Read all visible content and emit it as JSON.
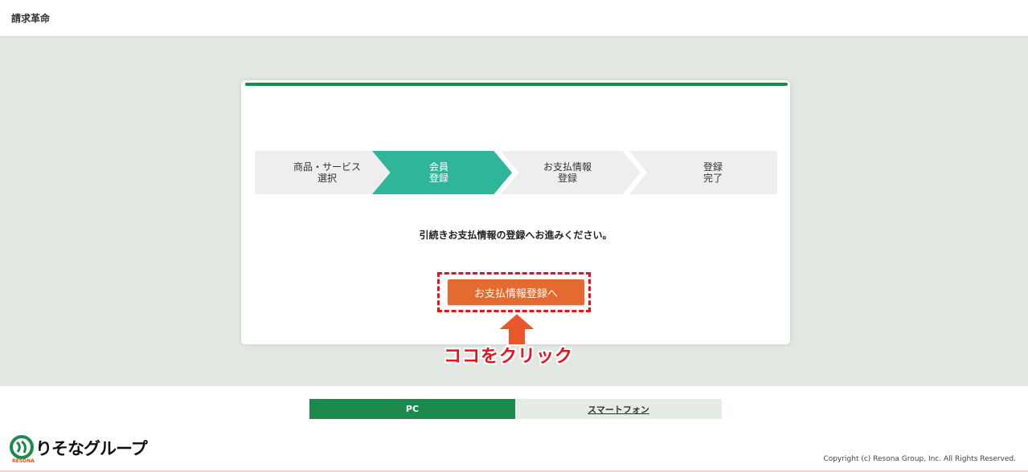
{
  "header": {
    "title": "請求革命"
  },
  "stepper": {
    "steps": [
      {
        "label": "商品・サービス\n選択",
        "state": "done"
      },
      {
        "label": "会員\n登録",
        "state": "active"
      },
      {
        "label": "お支払情報\n登録",
        "state": "pending"
      },
      {
        "label": "登録\n完了",
        "state": "pending"
      }
    ]
  },
  "main": {
    "message": "引続きお支払情報の登録へお進みください。",
    "cta_label": "お支払情報登録へ",
    "annotation": "ココをクリック"
  },
  "view_switch": {
    "pc_label": "PC",
    "smartphone_label": "スマートフォン"
  },
  "footer": {
    "logo_text": "りそなグループ",
    "logo_sub": "RESONA",
    "copyright": "Copyright (c) Resona Group, Inc. All Rights Reserved."
  },
  "colors": {
    "brand_green": "#1b8a4c",
    "active_step": "#2fb69a",
    "cta_orange": "#e46a2f",
    "annotation_red": "#e8101e"
  }
}
